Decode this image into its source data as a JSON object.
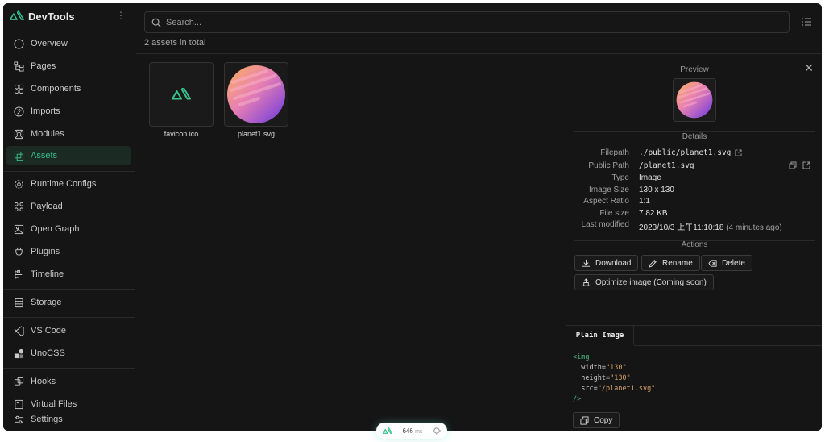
{
  "app": {
    "title": "DevTools"
  },
  "sidebar": {
    "items": [
      {
        "label": "Overview",
        "icon": "info-icon"
      },
      {
        "label": "Pages",
        "icon": "tree-icon"
      },
      {
        "label": "Components",
        "icon": "components-icon"
      },
      {
        "label": "Imports",
        "icon": "imports-icon"
      },
      {
        "label": "Modules",
        "icon": "modules-icon"
      },
      {
        "label": "Assets",
        "icon": "assets-icon",
        "active": true
      },
      {
        "label": "Runtime Configs",
        "icon": "gear-icon"
      },
      {
        "label": "Payload",
        "icon": "payload-icon"
      },
      {
        "label": "Open Graph",
        "icon": "image-icon"
      },
      {
        "label": "Plugins",
        "icon": "plug-icon"
      },
      {
        "label": "Timeline",
        "icon": "timeline-icon"
      },
      {
        "label": "Storage",
        "icon": "storage-icon"
      },
      {
        "label": "VS Code",
        "icon": "vscode-icon"
      },
      {
        "label": "UnoCSS",
        "icon": "unocss-icon"
      },
      {
        "label": "Hooks",
        "icon": "hooks-icon"
      },
      {
        "label": "Virtual Files",
        "icon": "file-icon"
      },
      {
        "label": "Settings",
        "icon": "settings-icon"
      }
    ]
  },
  "search": {
    "placeholder": "Search..."
  },
  "assets": {
    "count_text": "2 assets in total",
    "items": [
      {
        "name": "favicon.ico"
      },
      {
        "name": "planet1.svg"
      }
    ]
  },
  "panel": {
    "preview_title": "Preview",
    "details_title": "Details",
    "details": [
      {
        "key": "Filepath",
        "value": "./public/planet1.svg"
      },
      {
        "key": "Public Path",
        "value": "/planet1.svg"
      },
      {
        "key": "Type",
        "value": "Image"
      },
      {
        "key": "Image Size",
        "value": "130 x 130"
      },
      {
        "key": "Aspect Ratio",
        "value": "1:1"
      },
      {
        "key": "File size",
        "value": "7.82 KB"
      },
      {
        "key": "Last modified",
        "value": "2023/10/3 上午11:10:18",
        "extra": "(4 minutes ago)"
      }
    ],
    "actions_title": "Actions",
    "actions": {
      "download": "Download",
      "rename": "Rename",
      "delete": "Delete",
      "optimize": "Optimize image (Coming soon)"
    },
    "code_tab": "Plain Image",
    "code": {
      "open": "<img",
      "width_attr": "width=",
      "width_val": "\"130\"",
      "height_attr": "height=",
      "height_val": "\"130\"",
      "src_attr": "src=",
      "src_val": "\"/planet1.svg\"",
      "close": "/>"
    },
    "copy_label": "Copy"
  },
  "footer": {
    "ms_value": "646",
    "ms_unit": "ms"
  },
  "colors": {
    "accent": "#36c08a",
    "background": "#151515"
  }
}
